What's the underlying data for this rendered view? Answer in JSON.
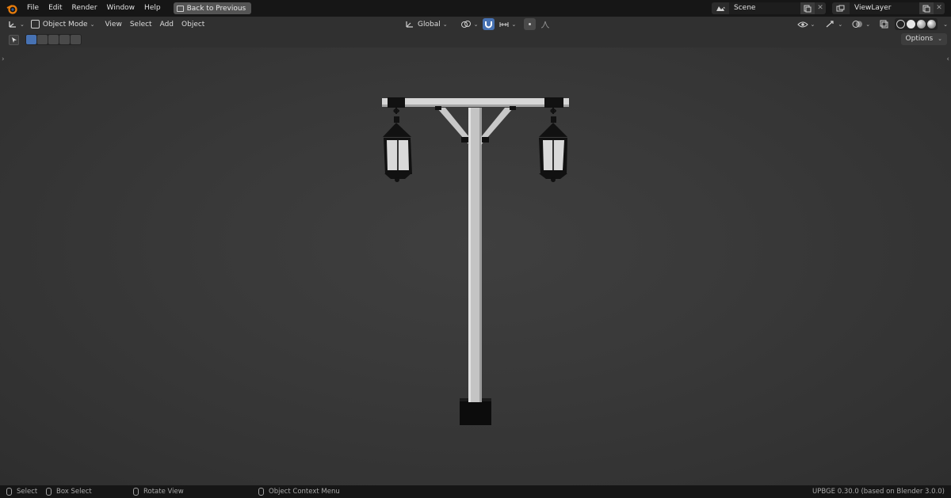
{
  "topbar": {
    "menu": [
      "File",
      "Edit",
      "Render",
      "Window",
      "Help"
    ],
    "back_button": "Back to Previous",
    "scene_name": "Scene",
    "view_layer": "ViewLayer"
  },
  "header": {
    "mode": "Object Mode",
    "menus": [
      "View",
      "Select",
      "Add",
      "Object"
    ],
    "transform_orientation": "Global"
  },
  "toolrow": {
    "options_label": "Options"
  },
  "statusbar": {
    "select": "Select",
    "box_select": "Box Select",
    "rotate_view": "Rotate View",
    "context_menu": "Object Context Menu",
    "version": "UPBGE 0.30.0 (based on Blender 3.0.0)"
  },
  "colors": {
    "accent": "#4772b3",
    "topbar": "#161616",
    "viewport": "#393939"
  }
}
